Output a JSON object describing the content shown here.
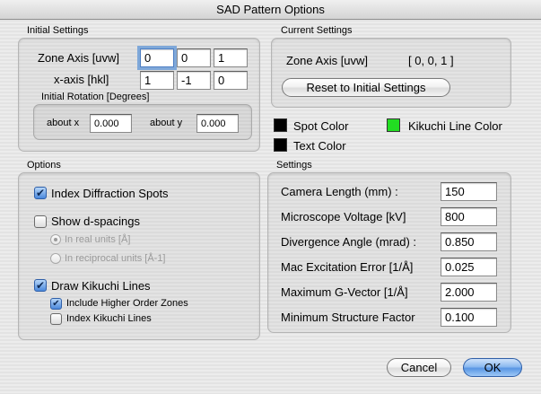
{
  "window": {
    "title": "SAD Pattern Options"
  },
  "initial_settings": {
    "label": "Initial Settings",
    "zone_axis_label": "Zone Axis [uvw]",
    "zone_axis": [
      "0",
      "0",
      "1"
    ],
    "x_axis_label": "x-axis [hkl]",
    "x_axis": [
      "1",
      "-1",
      "0"
    ],
    "rotation_label": "Initial Rotation [Degrees]",
    "about_x_label": "about x",
    "about_x": "0.000",
    "about_y_label": "about y",
    "about_y": "0.000"
  },
  "current_settings": {
    "label": "Current Settings",
    "zone_axis_label": "Zone Axis [uvw]",
    "zone_axis_value": "[ 0, 0, 1 ]",
    "reset_button": "Reset to Initial Settings"
  },
  "colors": {
    "spot_color_label": "Spot Color",
    "spot_color": "#000000",
    "text_color_label": "Text Color",
    "text_color": "#000000",
    "kikuchi_color_label": "Kikuchi Line Color",
    "kikuchi_color": "#22dd22"
  },
  "options": {
    "label": "Options",
    "index_spots": {
      "label": "Index Diffraction Spots",
      "checked": true
    },
    "show_d_spacings": {
      "label": "Show d-spacings",
      "checked": false
    },
    "real_units": {
      "label": "In real units [Å]",
      "selected": true,
      "enabled": false
    },
    "reciprocal_units": {
      "label": "In reciprocal units [Å-1]",
      "selected": false,
      "enabled": false
    },
    "draw_kikuchi": {
      "label": "Draw Kikuchi Lines",
      "checked": true
    },
    "higher_order": {
      "label": "Include Higher Order Zones",
      "checked": true
    },
    "index_kikuchi": {
      "label": "Index Kikuchi Lines",
      "checked": false
    }
  },
  "settings": {
    "label": "Settings",
    "rows": [
      {
        "label": "Camera Length (mm) :",
        "value": "150"
      },
      {
        "label": "Microscope Voltage [kV]",
        "value": "800"
      },
      {
        "label": "Divergence Angle (mrad) :",
        "value": "0.850"
      },
      {
        "label": "Mac Excitation Error [1/Å]",
        "value": "0.025"
      },
      {
        "label": "Maximum G-Vector [1/Å]",
        "value": "2.000"
      },
      {
        "label": "Minimum Structure Factor",
        "value": "0.100"
      }
    ]
  },
  "buttons": {
    "cancel": "Cancel",
    "ok": "OK"
  }
}
